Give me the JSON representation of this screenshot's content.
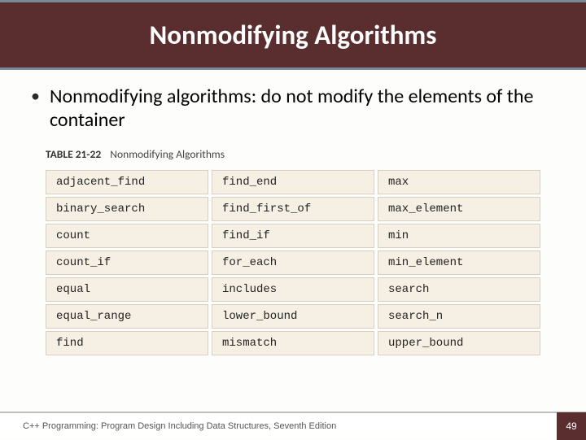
{
  "header": {
    "title": "Nonmodifying Algorithms"
  },
  "bullet": {
    "text": "Nonmodifying algorithms: do not modify the elements of the container"
  },
  "table": {
    "caption_label": "TABLE 21-22",
    "caption_title": "Nonmodifying Algorithms",
    "rows": [
      [
        "adjacent_find",
        "find_end",
        "max"
      ],
      [
        "binary_search",
        "find_first_of",
        "max_element"
      ],
      [
        "count",
        "find_if",
        "min"
      ],
      [
        "count_if",
        "for_each",
        "min_element"
      ],
      [
        "equal",
        "includes",
        "search"
      ],
      [
        "equal_range",
        "lower_bound",
        "search_n"
      ],
      [
        "find",
        "mismatch",
        "upper_bound"
      ]
    ]
  },
  "footer": {
    "text": "C++ Programming: Program Design Including Data Structures, Seventh Edition",
    "page": "49"
  }
}
